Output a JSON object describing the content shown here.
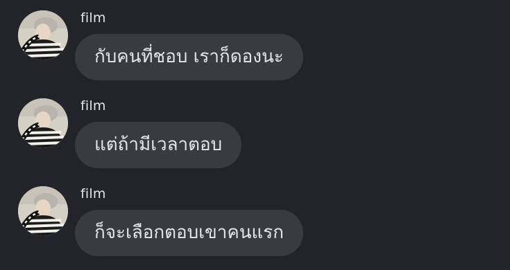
{
  "conversation": {
    "messages": [
      {
        "sender": "film",
        "text": "กับคนที่ชอบ เราก็ดองนะ",
        "avatar_icon": "user-avatar-photo"
      },
      {
        "sender": "film",
        "text": "แต่ถ้ามีเวลาตอบ",
        "avatar_icon": "user-avatar-photo"
      },
      {
        "sender": "film",
        "text": "ก็จะเลือกตอบเขาคนแรก",
        "avatar_icon": "user-avatar-photo"
      }
    ]
  },
  "colors": {
    "background": "#232429",
    "bubble": "#3a3b40",
    "text": "#e4e6eb"
  }
}
